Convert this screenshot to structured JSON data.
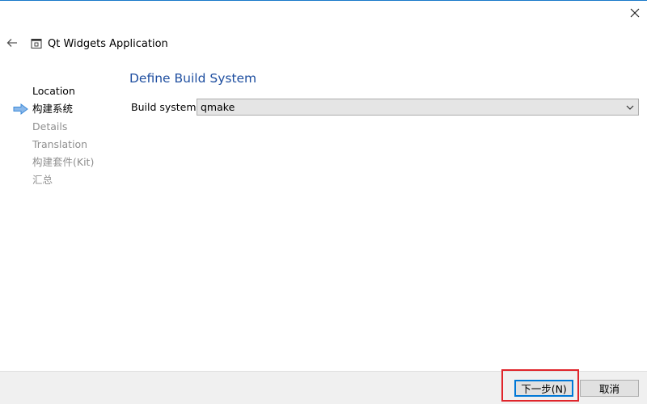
{
  "window": {
    "title": "Qt Widgets Application",
    "accent_color": "#1979ca",
    "close_icon": "close-icon",
    "back_icon": "back-arrow-icon"
  },
  "sidebar": {
    "steps": [
      {
        "label": "Location",
        "state": "done"
      },
      {
        "label": "构建系统",
        "state": "current"
      },
      {
        "label": "Details",
        "state": "pending"
      },
      {
        "label": "Translation",
        "state": "pending"
      },
      {
        "label": "构建套件(Kit)",
        "state": "pending"
      },
      {
        "label": "汇总",
        "state": "pending"
      }
    ],
    "current_marker_icon": "right-arrow-icon",
    "marker_color": "#3c8ad8"
  },
  "main": {
    "title": "Define Build System",
    "title_color": "#1f4fa0",
    "build_system_label": "Build system:",
    "build_system_value": "qmake"
  },
  "footer": {
    "next_label": "下一步(N)",
    "cancel_label": "取消",
    "highlight_color": "#e0252b"
  }
}
